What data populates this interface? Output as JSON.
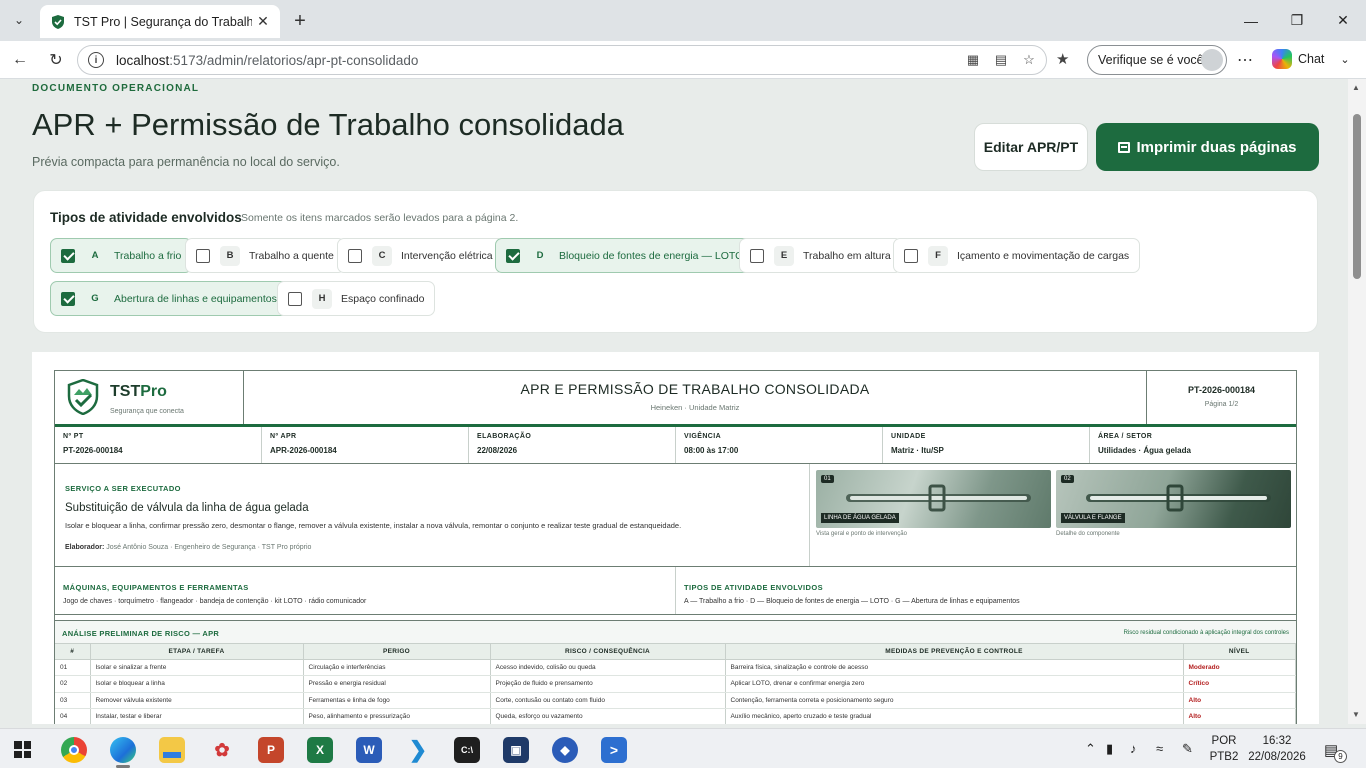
{
  "browser": {
    "tab_title": "TST Pro | Segurança do Trabalho",
    "url_host": "localhost",
    "url_path": ":5173/admin/relatorios/apr-pt-consolidado",
    "verify_label": "Verifique se é você",
    "chat_label": "Chat"
  },
  "header": {
    "eyebrow": "DOCUMENTO OPERACIONAL",
    "title": "APR + Permissão de Trabalho consolidada",
    "subtitle": "Prévia compacta para permanência no local do serviço.",
    "edit_label": "Editar APR/PT",
    "print_label": "Imprimir duas páginas"
  },
  "activities": {
    "title": "Tipos de atividade envolvidos",
    "hint": "Somente os itens marcados serão levados para a página 2.",
    "items": [
      {
        "letter": "A",
        "label": "Trabalho a frio",
        "checked": true
      },
      {
        "letter": "B",
        "label": "Trabalho a quente",
        "checked": false
      },
      {
        "letter": "C",
        "label": "Intervenção elétrica",
        "checked": false
      },
      {
        "letter": "D",
        "label": "Bloqueio de fontes de energia — LOTO",
        "checked": true
      },
      {
        "letter": "E",
        "label": "Trabalho em altura",
        "checked": false
      },
      {
        "letter": "F",
        "label": "Içamento e movimentação de cargas",
        "checked": false
      },
      {
        "letter": "G",
        "label": "Abertura de linhas e equipamentos",
        "checked": true
      },
      {
        "letter": "H",
        "label": "Espaço confinado",
        "checked": false
      }
    ]
  },
  "doc": {
    "brand_a": "TST",
    "brand_b": "Pro",
    "tagline": "Segurança que conecta",
    "title": "APR E PERMISSÃO DE TRABALHO CONSOLIDADA",
    "subtitle": "Heineken · Unidade Matriz",
    "number": "PT-2026-000184",
    "page": "Página 1/2",
    "meta": [
      {
        "label": "Nº PT",
        "value": "PT-2026-000184"
      },
      {
        "label": "Nº APR",
        "value": "APR-2026-000184"
      },
      {
        "label": "ELABORAÇÃO",
        "value": "22/08/2026"
      },
      {
        "label": "VIGÊNCIA",
        "value": "08:00 às 17:00"
      },
      {
        "label": "UNIDADE",
        "value": "Matriz · Itu/SP"
      },
      {
        "label": "ÁREA / SETOR",
        "value": "Utilidades · Água gelada"
      }
    ],
    "service_label": "SERVIÇO A SER EXECUTADO",
    "service_title": "Substituição de válvula da linha de água gelada",
    "service_desc": "Isolar e bloquear a linha, confirmar pressão zero, desmontar o flange, remover a válvula existente, instalar a nova válvula, remontar o conjunto e realizar teste gradual de estanqueidade.",
    "author_label": "Elaborador:",
    "author_value": "José Antônio Souza · Engenheiro de Segurança · TST Pro próprio",
    "photos": [
      {
        "idx": "01",
        "tag": "LINHA DE ÁGUA GELADA",
        "caption": "Vista geral e ponto de intervenção"
      },
      {
        "idx": "02",
        "tag": "VÁLVULA E FLANGE",
        "caption": "Detalhe do componente"
      }
    ],
    "machines_label": "MÁQUINAS, EQUIPAMENTOS E FERRAMENTAS",
    "machines_value": "Jogo de chaves · torquímetro · flangeador · bandeja de contenção · kit LOTO · rádio comunicador",
    "types_label": "TIPOS DE ATIVIDADE ENVOLVIDOS",
    "types_value": "A — Trabalho a frio · D — Bloqueio de fontes de energia — LOTO · G — Abertura de linhas e equipamentos",
    "apr_title": "ANÁLISE PRELIMINAR DE RISCO — APR",
    "apr_note": "Risco residual condicionado à aplicação integral dos controles",
    "apr_cols": [
      "#",
      "ETAPA / TAREFA",
      "PERIGO",
      "RISCO / CONSEQUÊNCIA",
      "MEDIDAS DE PREVENÇÃO E CONTROLE",
      "NÍVEL"
    ],
    "apr_rows": [
      [
        "01",
        "Isolar e sinalizar a frente",
        "Circulação e interferências",
        "Acesso indevido, colisão ou queda",
        "Barreira física, sinalização e controle de acesso",
        "Moderado"
      ],
      [
        "02",
        "Isolar e bloquear a linha",
        "Pressão e energia residual",
        "Projeção de fluido e prensamento",
        "Aplicar LOTO, drenar e confirmar energia zero",
        "Crítico"
      ],
      [
        "03",
        "Remover válvula existente",
        "Ferramentas e linha de fogo",
        "Corte, contusão ou contato com fluido",
        "Contenção, ferramenta correta e posicionamento seguro",
        "Alto"
      ],
      [
        "04",
        "Instalar, testar e liberar",
        "Peso, alinhamento e pressurização",
        "Queda, esforço ou vazamento",
        "Auxílio mecânico, aperto cruzado e teste gradual",
        "Alto"
      ]
    ]
  },
  "taskbar": {
    "lang_a": "POR",
    "lang_b": "PTB2",
    "time": "16:32",
    "date": "22/08/2026",
    "notif": "9"
  }
}
